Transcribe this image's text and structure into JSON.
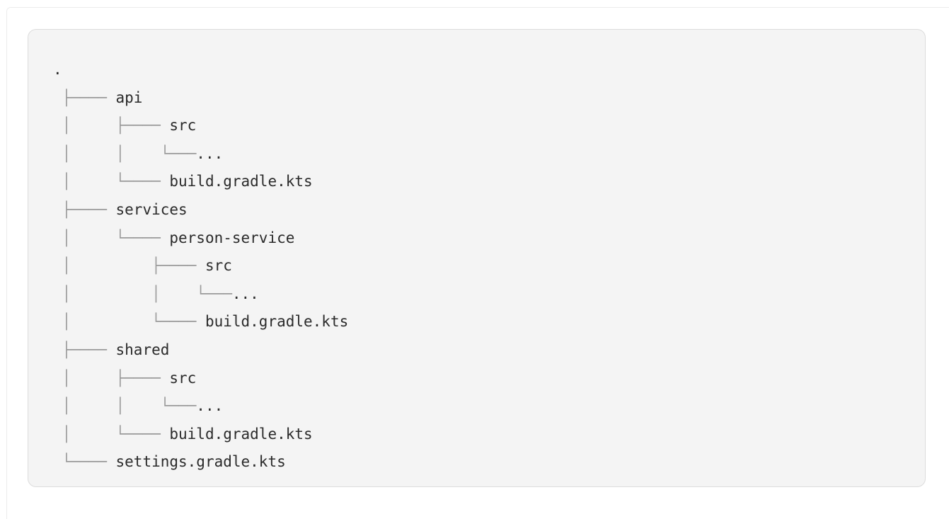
{
  "code_block": {
    "lines": [
      {
        "prefix": "",
        "name": "."
      },
      {
        "prefix": " ├──── ",
        "name": "api"
      },
      {
        "prefix": " │     ├──── ",
        "name": "src"
      },
      {
        "prefix": " │     │    └───",
        "name": "..."
      },
      {
        "prefix": " │     └──── ",
        "name": "build.gradle.kts"
      },
      {
        "prefix": " ├──── ",
        "name": "services"
      },
      {
        "prefix": " │     └──── ",
        "name": "person-service"
      },
      {
        "prefix": " │         ├──── ",
        "name": "src"
      },
      {
        "prefix": " │         │    └───",
        "name": "..."
      },
      {
        "prefix": " │         └──── ",
        "name": "build.gradle.kts"
      },
      {
        "prefix": " ├──── ",
        "name": "shared"
      },
      {
        "prefix": " │     ├──── ",
        "name": "src"
      },
      {
        "prefix": " │     │    └───",
        "name": "..."
      },
      {
        "prefix": " │     └──── ",
        "name": "build.gradle.kts"
      },
      {
        "prefix": " └──── ",
        "name": "settings.gradle.kts"
      }
    ]
  }
}
